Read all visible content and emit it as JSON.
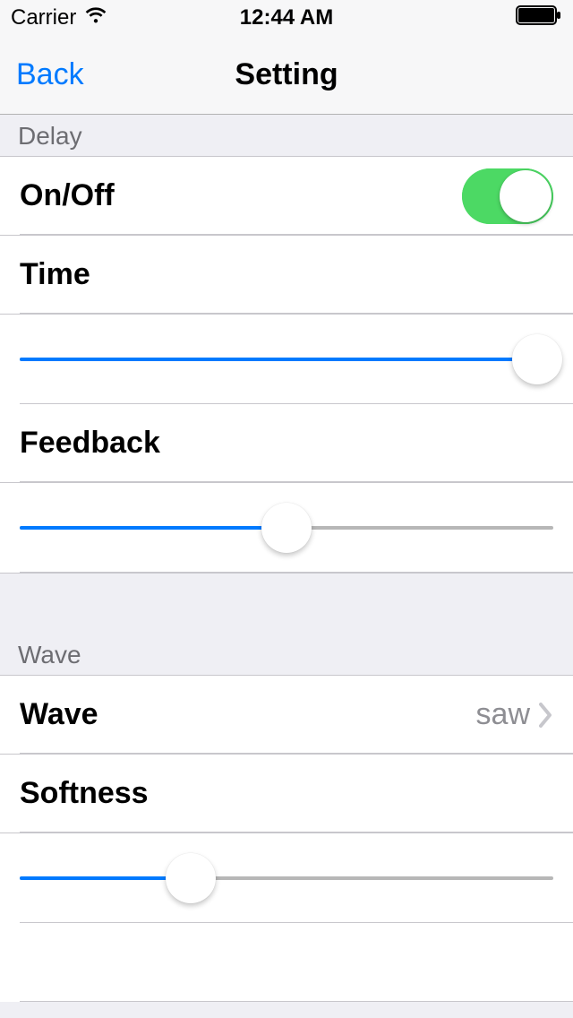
{
  "status_bar": {
    "carrier": "Carrier",
    "time": "12:44 AM"
  },
  "nav": {
    "back": "Back",
    "title": "Setting"
  },
  "sections": {
    "delay": {
      "header": "Delay",
      "onoff_label": "On/Off",
      "onoff_value": true,
      "time_label": "Time",
      "time_slider_pct": 97,
      "feedback_label": "Feedback",
      "feedback_slider_pct": 50
    },
    "wave": {
      "header": "Wave",
      "wave_label": "Wave",
      "wave_value": "saw",
      "softness_label": "Softness",
      "softness_slider_pct": 32
    }
  }
}
